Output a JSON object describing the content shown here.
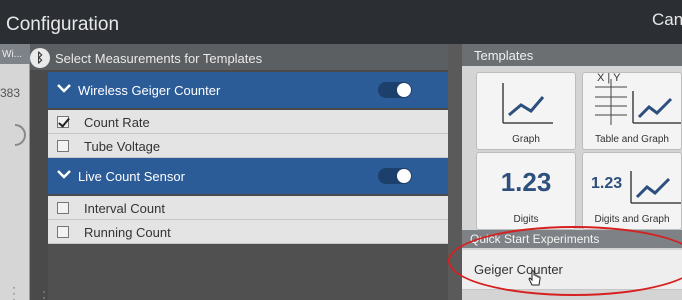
{
  "window": {
    "title": "Configuration",
    "cancel_label": "Cancel"
  },
  "left_strip": {
    "header_fragment": "Wi...",
    "value_fragment": "383"
  },
  "measurements_panel": {
    "heading": "Select Measurements for Templates",
    "sensors": [
      {
        "name": "Wireless Geiger Counter",
        "enabled": true,
        "measurements": [
          {
            "label": "Count Rate",
            "checked": true
          },
          {
            "label": "Tube Voltage",
            "checked": false
          }
        ]
      },
      {
        "name": "Live Count Sensor",
        "enabled": true,
        "measurements": [
          {
            "label": "Interval Count",
            "checked": false
          },
          {
            "label": "Running Count",
            "checked": false
          }
        ]
      }
    ]
  },
  "templates_panel": {
    "heading": "Templates",
    "tiles": [
      {
        "label": "Graph",
        "icon": "graph-icon"
      },
      {
        "label": "Table and Graph",
        "icon": "table-graph-icon",
        "table_header": "X | Y"
      },
      {
        "label": "Digits",
        "icon": "digits-icon",
        "display": "1.23"
      },
      {
        "label": "Digits and Graph",
        "icon": "digits-graph-icon",
        "display": "1.23"
      }
    ]
  },
  "quick_start": {
    "heading": "Quick Start Experiments",
    "items": [
      {
        "label": "Geiger Counter"
      }
    ]
  },
  "colors": {
    "sensor_header": "#2c5c98",
    "annotation_circle": "#d62020",
    "digits_text": "#2d4f7d"
  }
}
